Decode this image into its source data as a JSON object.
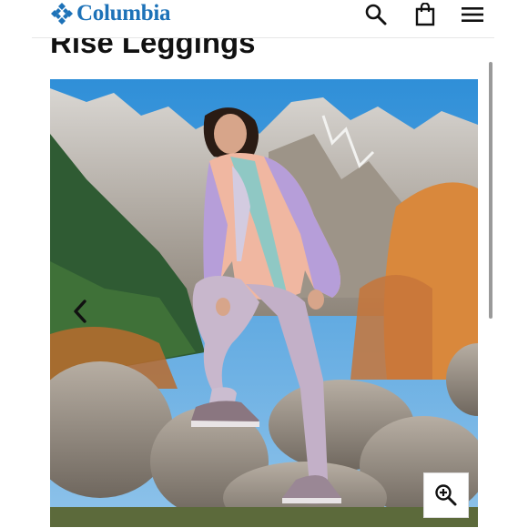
{
  "brand": {
    "name": "Columbia",
    "color": "#1d72b8"
  },
  "header": {
    "icons": [
      "search-icon",
      "shopping-bag-icon",
      "hamburger-menu-icon"
    ]
  },
  "product": {
    "title_visible": "Rise Leggings"
  },
  "gallery": {
    "image_alt": "Woman hiking in lavender leggings and colorblock windbreaker, standing on a boulder with mountains behind",
    "controls": [
      "chevron-left-icon",
      "zoom-in-icon"
    ]
  }
}
